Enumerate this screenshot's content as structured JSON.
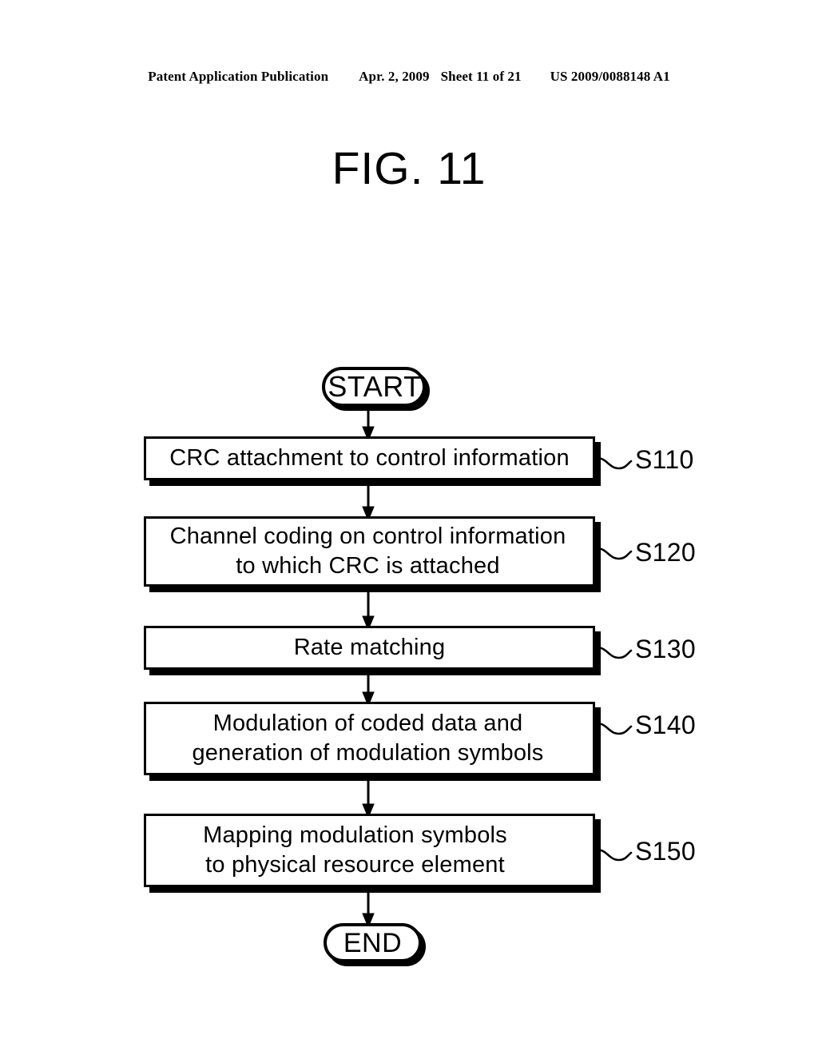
{
  "header": {
    "publication": "Patent Application Publication",
    "date": "Apr. 2, 2009",
    "sheet": "Sheet 11 of 21",
    "patent_number": "US 2009/0088148 A1"
  },
  "figure": {
    "title": "FIG. 11"
  },
  "flowchart": {
    "start_label": "START",
    "end_label": "END",
    "steps": [
      {
        "id": "S110",
        "text": "CRC attachment to control information",
        "ref": "S110"
      },
      {
        "id": "S120",
        "text": "Channel coding on control information\nto which CRC is attached",
        "ref": "S120"
      },
      {
        "id": "S130",
        "text": "Rate matching",
        "ref": "S130"
      },
      {
        "id": "S140",
        "text": "Modulation of coded data and\ngeneration of modulation symbols",
        "ref": "S140"
      },
      {
        "id": "S150",
        "text": "Mapping modulation symbols\nto physical resource element",
        "ref": "S150"
      }
    ]
  },
  "colors": {
    "ink": "#000000",
    "paper": "#ffffff"
  }
}
